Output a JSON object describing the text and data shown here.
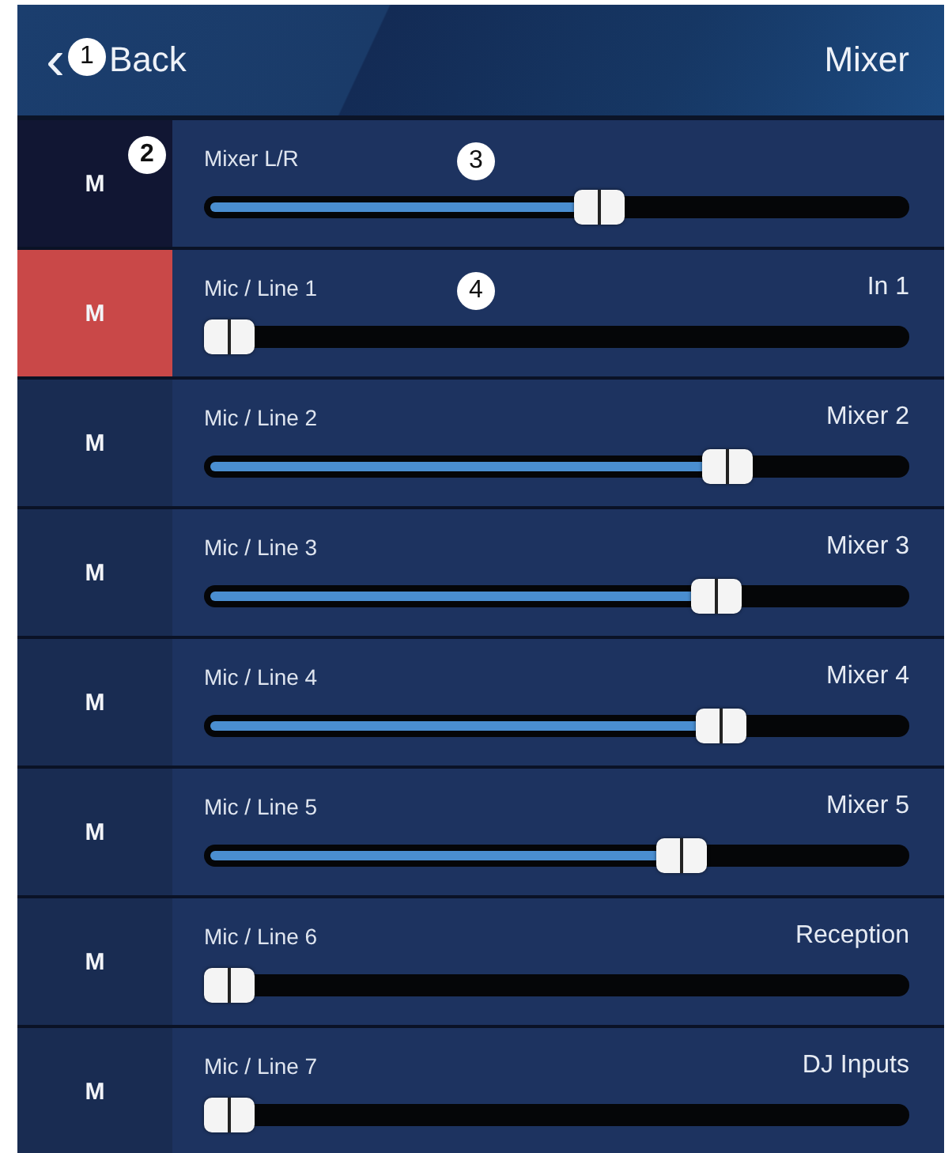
{
  "header": {
    "back": {
      "icon": "‹",
      "label": "Back",
      "callout": "1"
    },
    "title": "Mixer"
  },
  "channels": [
    {
      "mute": {
        "label": "M",
        "muted": false,
        "selected": true,
        "callout": "2"
      },
      "name": "Mixer L/R",
      "callout": "3",
      "level": 0.565
    },
    {
      "mute": {
        "label": "M",
        "muted": true,
        "selected": false
      },
      "name": "Mic / Line 1",
      "callout": "4",
      "output": "In 1",
      "level": 0
    },
    {
      "mute": {
        "label": "M",
        "muted": false,
        "selected": false
      },
      "name": "Mic / Line 2",
      "output": "Mixer 2",
      "level": 0.76
    },
    {
      "mute": {
        "label": "M",
        "muted": false,
        "selected": false
      },
      "name": "Mic / Line 3",
      "output": "Mixer 3",
      "level": 0.745
    },
    {
      "mute": {
        "label": "M",
        "muted": false,
        "selected": false
      },
      "name": "Mic / Line 4",
      "output": "Mixer 4",
      "level": 0.75
    },
    {
      "mute": {
        "label": "M",
        "muted": false,
        "selected": false
      },
      "name": "Mic / Line 5",
      "output": "Mixer 5",
      "level": 0.69
    },
    {
      "mute": {
        "label": "M",
        "muted": false,
        "selected": false
      },
      "name": "Mic / Line 6",
      "output": "Reception",
      "level": 0
    },
    {
      "mute": {
        "label": "M",
        "muted": false,
        "selected": false
      },
      "name": "Mic / Line 7",
      "output": "DJ Inputs",
      "level": 0
    }
  ]
}
